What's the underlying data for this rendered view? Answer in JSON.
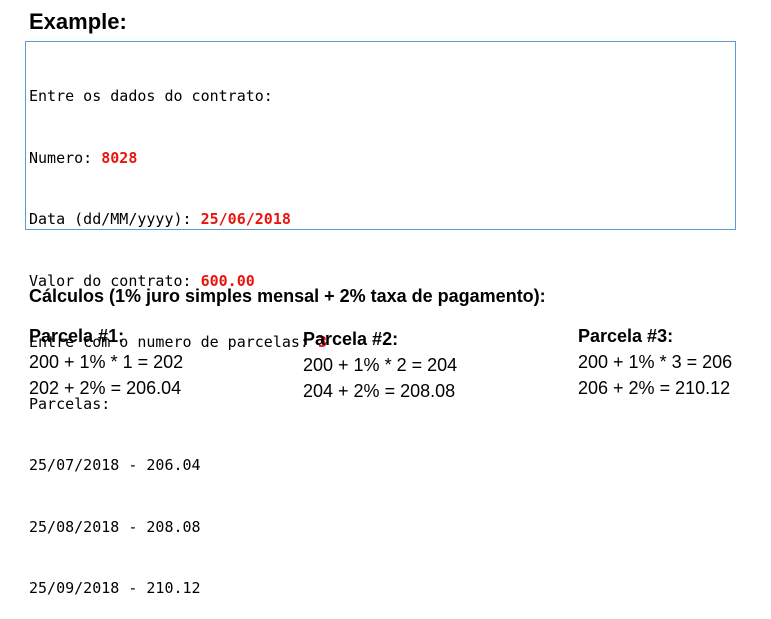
{
  "title": "Example:",
  "console": {
    "line1": "Entre os dados do contrato:",
    "numero_label": "Numero: ",
    "numero_value": "8028",
    "data_label": "Data (dd/MM/yyyy): ",
    "data_value": "25/06/2018",
    "valor_label": "Valor do contrato: ",
    "valor_value": "600.00",
    "parcelas_prompt_label": "Entre com o numero de parcelas: ",
    "parcelas_prompt_value": "3",
    "parcelas_header": "Parcelas:",
    "installments": [
      "25/07/2018 - 206.04",
      "25/08/2018 - 208.08",
      "25/09/2018 - 210.12"
    ],
    "highlight_color": "#e8140e"
  },
  "calculations": {
    "title": "Cálculos (1% juro simples mensal + 2% taxa de pagamento):",
    "columns": [
      {
        "heading": "Parcela #1:",
        "line1": "200 + 1% * 1 = 202",
        "line2": "202 + 2% = 206.04"
      },
      {
        "heading": "Parcela #2:",
        "line1": "200 + 1% * 2 = 204",
        "line2": "204 + 2% = 208.08"
      },
      {
        "heading": "Parcela #3:",
        "line1": "200 + 1% * 3 = 206",
        "line2": "206 + 2% = 210.12"
      }
    ]
  }
}
